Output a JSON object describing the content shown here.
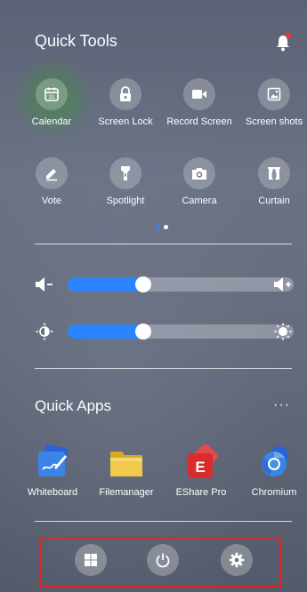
{
  "quick_tools": {
    "title": "Quick Tools",
    "tools": [
      {
        "label": "Calendar",
        "icon": "calendar-icon",
        "badge": "31"
      },
      {
        "label": "Screen Lock",
        "icon": "lock-icon"
      },
      {
        "label": "Record Screen",
        "icon": "video-camera-icon"
      },
      {
        "label": "Screen shots",
        "icon": "screenshot-icon"
      },
      {
        "label": "Vote",
        "icon": "vote-icon"
      },
      {
        "label": "Spotlight",
        "icon": "flashlight-icon"
      },
      {
        "label": "Camera",
        "icon": "camera-icon"
      },
      {
        "label": "Curtain",
        "icon": "curtain-icon"
      }
    ],
    "page_indicator": {
      "pages": 2,
      "active": 1,
      "active_color": "#2b84ff",
      "inactive_color": "#ffffff"
    }
  },
  "volume": {
    "level": 0.3,
    "accent": "#2b84ff"
  },
  "brightness": {
    "level": 0.3,
    "accent": "#2b84ff"
  },
  "quick_apps": {
    "title": "Quick Apps",
    "more_label": "···",
    "apps": [
      {
        "label": "Whiteboard",
        "icon": "whiteboard-icon"
      },
      {
        "label": "Filemanager",
        "icon": "folder-icon"
      },
      {
        "label": "EShare Pro",
        "icon": "eshare-icon"
      },
      {
        "label": "Chromium",
        "icon": "chromium-icon"
      }
    ]
  },
  "dock": {
    "buttons": [
      {
        "name": "windows-button",
        "icon": "windows-icon"
      },
      {
        "name": "power-button",
        "icon": "power-icon"
      },
      {
        "name": "settings-button",
        "icon": "gear-icon"
      }
    ],
    "highlight_color": "#e02525"
  }
}
